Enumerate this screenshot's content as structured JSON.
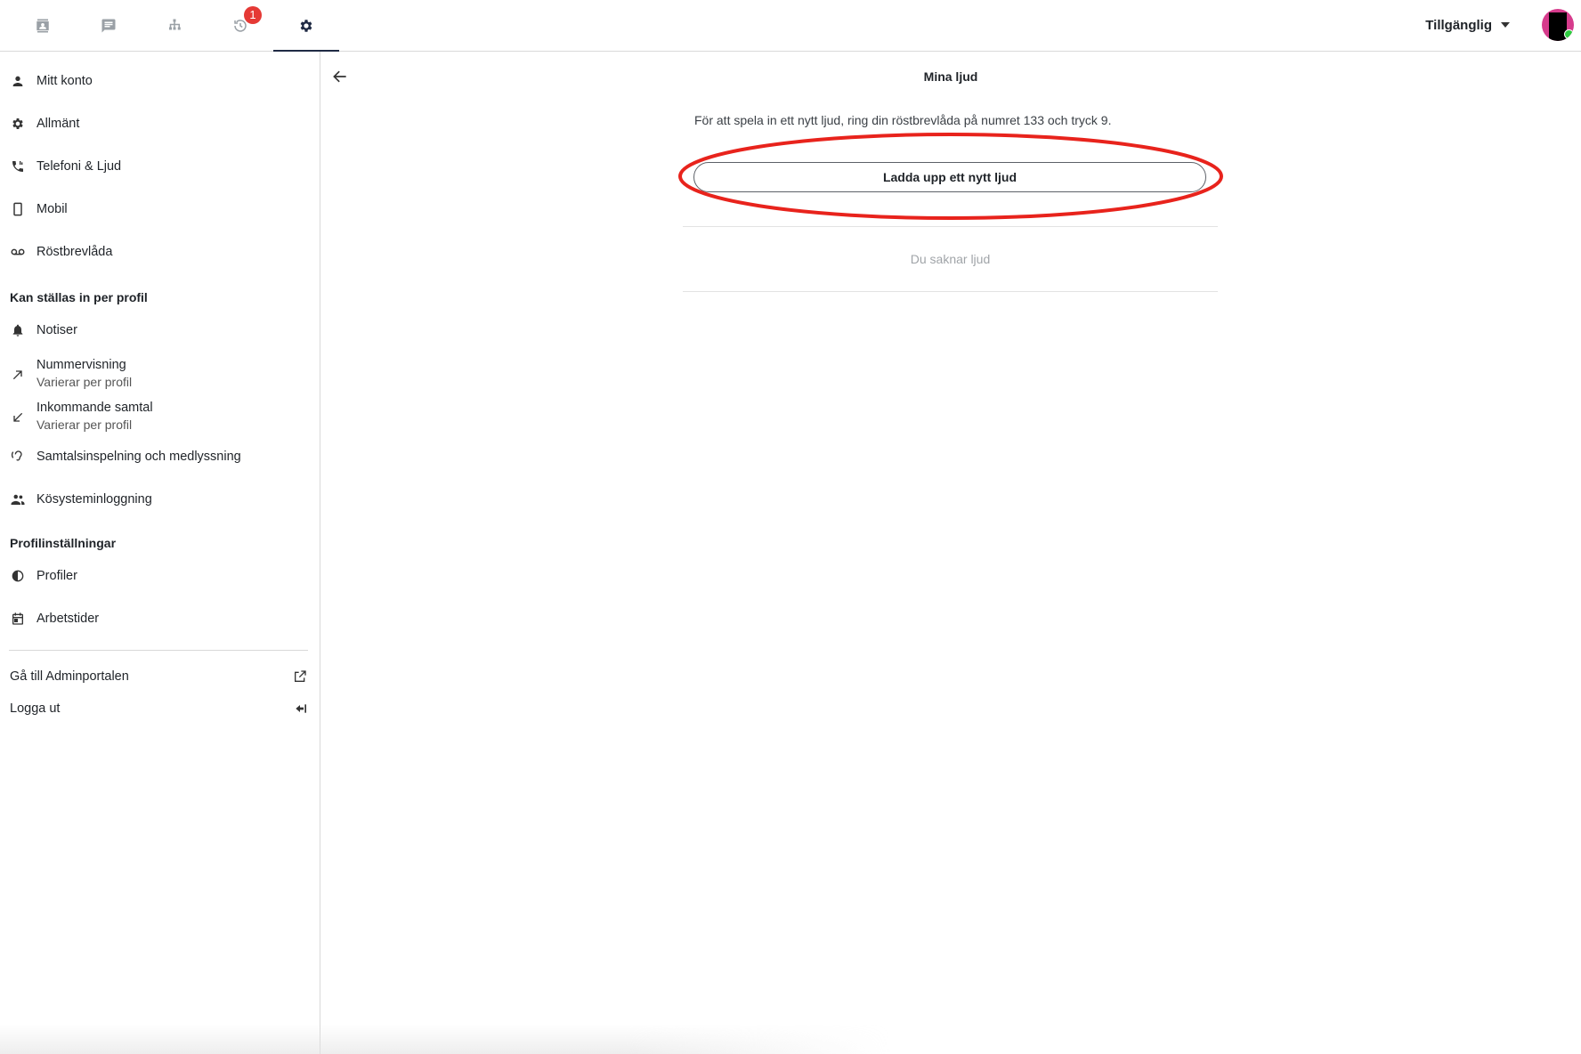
{
  "topbar": {
    "tabs": [
      {
        "icon": "contacts-icon",
        "active": false
      },
      {
        "icon": "chat-icon",
        "active": false
      },
      {
        "icon": "org-chart-icon",
        "active": false
      },
      {
        "icon": "call-history-icon",
        "active": false,
        "badge": "1"
      },
      {
        "icon": "gear-icon",
        "active": true
      }
    ],
    "status_label": "Tillgänglig",
    "status_color": "#2ecc40",
    "avatar_color": "#d63b8c"
  },
  "sidebar": {
    "items": [
      {
        "label": "Mitt konto",
        "icon": "person-icon"
      },
      {
        "label": "Allmänt",
        "icon": "gear-icon"
      },
      {
        "label": "Telefoni & Ljud",
        "icon": "phone-icon"
      },
      {
        "label": "Mobil",
        "icon": "mobile-icon"
      },
      {
        "label": "Röstbrevlåda",
        "icon": "voicemail-icon"
      }
    ],
    "section_profile": "Kan ställas in per profil",
    "profile_items": [
      {
        "label": "Notiser",
        "icon": "bell-icon"
      },
      {
        "label": "Nummervisning",
        "sublabel": "Varierar per profil",
        "icon": "arrow-outgoing-icon"
      },
      {
        "label": "Inkommande samtal",
        "sublabel": "Varierar per profil",
        "icon": "arrow-incoming-icon"
      },
      {
        "label": "Samtalsinspelning och medlyssning",
        "icon": "hearing-icon"
      },
      {
        "label": "Kösysteminloggning",
        "icon": "people-icon"
      }
    ],
    "section_settings": "Profilinställningar",
    "settings_items": [
      {
        "label": "Profiler",
        "icon": "contrast-icon"
      },
      {
        "label": "Arbetstider",
        "icon": "calendar-icon"
      }
    ],
    "footer": {
      "admin_label": "Gå till Adminportalen",
      "logout_label": "Logga ut"
    }
  },
  "main": {
    "title": "Mina ljud",
    "info": "För att spela in ett nytt ljud, ring din röstbrevlåda på numret 133 och tryck 9.",
    "upload_label": "Ladda upp ett nytt ljud",
    "empty_text": "Du saknar ljud",
    "highlight_color": "#e8231c"
  }
}
